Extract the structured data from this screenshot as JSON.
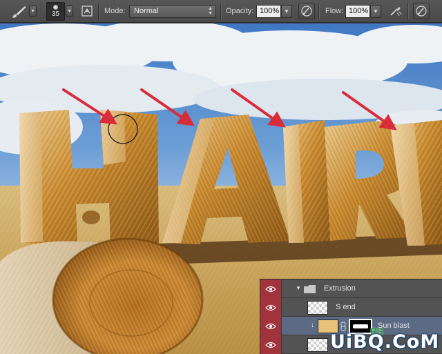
{
  "options_bar": {
    "brush_size": "35",
    "mode_label": "Mode:",
    "mode_value": "Normal",
    "opacity_label": "Opacity:",
    "opacity_value": "100%",
    "flow_label": "Flow:",
    "flow_value": "100%"
  },
  "canvas": {
    "headline": "HAIR",
    "colors": {
      "sky_top": "#3f78c2",
      "cloud": "#eef2f5",
      "field": "#c9a45c",
      "straw": "#c8892e",
      "arrow": "#d92c3a"
    }
  },
  "layers": {
    "rows": [
      {
        "name": "Extrusion",
        "type": "group"
      },
      {
        "name": "S end",
        "type": "layer"
      },
      {
        "name": "Sun blast",
        "type": "layer",
        "selected": true
      },
      {
        "name": "",
        "type": "layer"
      }
    ]
  },
  "watermark": {
    "text": "UiBQ.CoM",
    "sub": "PS"
  }
}
